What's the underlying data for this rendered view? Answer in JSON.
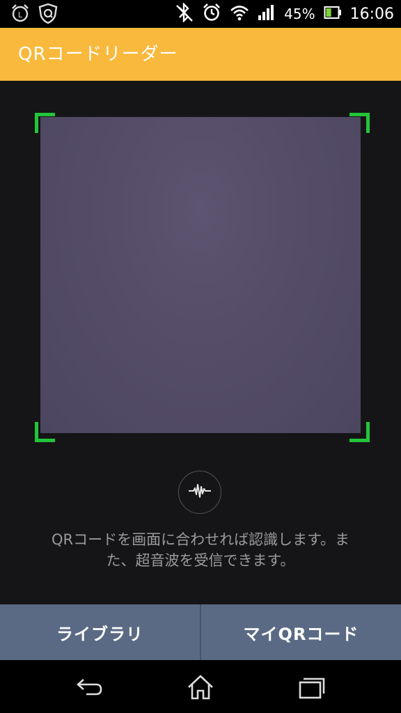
{
  "status_bar": {
    "icons_left": [
      "alarm-clock-icon",
      "shield-app-icon"
    ],
    "icons_right": [
      "bluetooth-icon",
      "alarm-icon",
      "wifi-icon",
      "signal-icon"
    ],
    "battery_percent": "45%",
    "battery_level": 0.45,
    "time": "16:06"
  },
  "app_bar": {
    "title": "QRコードリーダー",
    "color": "#f8b93c"
  },
  "scanner": {
    "frame_color": "#22c53a",
    "sound_icon": "sound-wave-icon",
    "instruction_line1": "QRコードを画面に合わせれば認識します。ま",
    "instruction_line2": "た、超音波を受信できます。"
  },
  "buttons": {
    "library": "ライブラリ",
    "my_qr": "マイQRコード"
  },
  "nav_bar": {
    "icons": [
      "back-icon",
      "home-icon",
      "recents-icon"
    ]
  }
}
